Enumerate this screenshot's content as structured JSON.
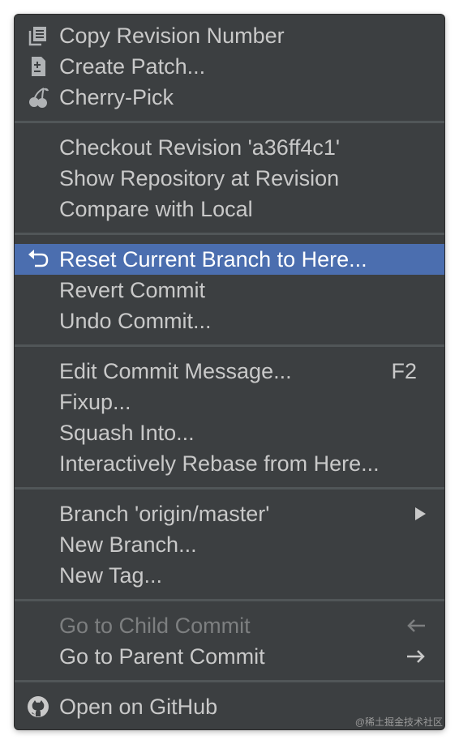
{
  "menu": {
    "copy_revision": "Copy Revision Number",
    "create_patch": "Create Patch...",
    "cherry_pick": "Cherry-Pick",
    "checkout_revision": "Checkout Revision 'a36ff4c1'",
    "show_repository": "Show Repository at Revision",
    "compare_local": "Compare with Local",
    "reset_branch": "Reset Current Branch to Here...",
    "revert_commit": "Revert Commit",
    "undo_commit": "Undo Commit...",
    "edit_message": "Edit Commit Message...",
    "edit_message_shortcut": "F2",
    "fixup": "Fixup...",
    "squash": "Squash Into...",
    "rebase": "Interactively Rebase from Here...",
    "branch_origin": "Branch 'origin/master'",
    "new_branch": "New Branch...",
    "new_tag": "New Tag...",
    "go_child": "Go to Child Commit",
    "go_parent": "Go to Parent Commit",
    "open_github": "Open on GitHub"
  },
  "icons": {
    "copy": "copy-icon",
    "patch": "patch-icon",
    "cherry": "cherry-icon",
    "reset": "reset-arrow-icon",
    "submenu": "submenu-triangle-icon",
    "left": "arrow-left-icon",
    "right": "arrow-right-icon",
    "github": "github-icon"
  },
  "colors": {
    "background": "#3c3f41",
    "selection": "#4b6eaf",
    "text": "#c9c9c9",
    "disabled_text": "#7d7f80",
    "separator": "#515658"
  },
  "watermark": "@稀土掘金技术社区"
}
